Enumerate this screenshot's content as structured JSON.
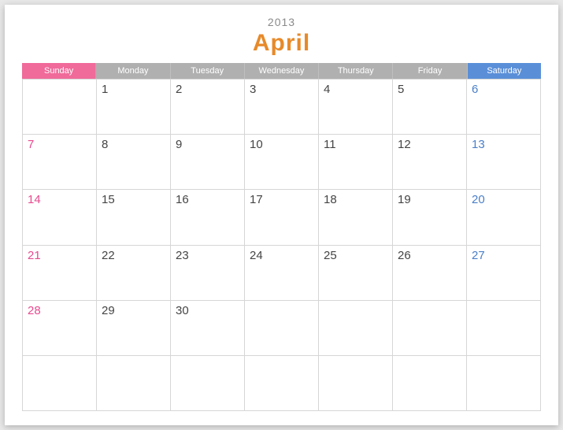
{
  "year": "2013",
  "month": "April",
  "days": [
    "Sunday",
    "Monday",
    "Tuesday",
    "Wednesday",
    "Thursday",
    "Friday",
    "Saturday"
  ],
  "weeks": [
    [
      "",
      "1",
      "2",
      "3",
      "4",
      "5",
      "6"
    ],
    [
      "7",
      "8",
      "9",
      "10",
      "11",
      "12",
      "13"
    ],
    [
      "14",
      "15",
      "16",
      "17",
      "18",
      "19",
      "20"
    ],
    [
      "21",
      "22",
      "23",
      "24",
      "25",
      "26",
      "27"
    ],
    [
      "28",
      "29",
      "30",
      "",
      "",
      "",
      ""
    ],
    [
      "",
      "",
      "",
      "",
      "",
      "",
      ""
    ]
  ]
}
